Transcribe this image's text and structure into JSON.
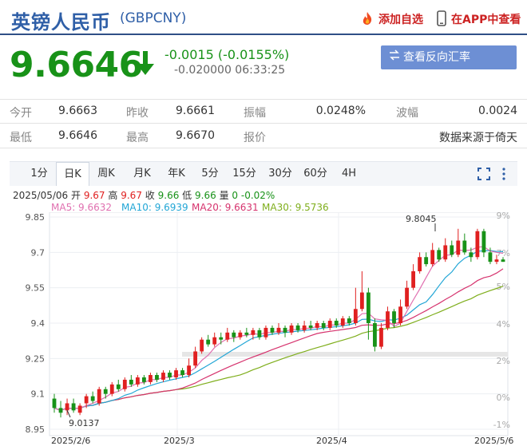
{
  "header": {
    "title": "英镑人民币",
    "code": "(GBPCNY)",
    "add_watch": "添加自选",
    "view_app": "在APP中查看"
  },
  "quote": {
    "price": "9.6646",
    "change": "-0.0015 (-0.0155%)",
    "sub": "-0.020000 06:33:25",
    "reverse_button": "查看反向汇率 CNYGBP"
  },
  "stats": {
    "row1": [
      {
        "label": "今开",
        "value": "9.6663"
      },
      {
        "label": "昨收",
        "value": "9.6661"
      },
      {
        "label": "振幅",
        "value": "0.0248%"
      },
      {
        "label": "波幅",
        "value": "0.0024"
      }
    ],
    "row2": [
      {
        "label": "最低",
        "value": "9.6646"
      },
      {
        "label": "最高",
        "value": "9.6670"
      },
      {
        "label": "报价",
        "value": ""
      },
      {
        "label": "",
        "value": "数据来源于倚天"
      }
    ]
  },
  "toolbar": {
    "tabs": [
      "1分",
      "日K",
      "周K",
      "月K",
      "年K",
      "5分",
      "15分",
      "30分",
      "60分",
      "4H"
    ],
    "active_tab": "日K"
  },
  "ohlc": {
    "date": "2025/05/06",
    "open_label": "开",
    "open": "9.67",
    "high_label": "高",
    "high": "9.67",
    "close_label": "收",
    "close": "9.66",
    "low_label": "低",
    "low": "9.66",
    "vol_label": "量",
    "vol": "0",
    "change": "-0.02%"
  },
  "ma_legend": [
    {
      "text": "MA5: 9.6632",
      "color": "#e070b0"
    },
    {
      "text": "MA10: 9.6939",
      "color": "#22a6d6"
    },
    {
      "text": "MA20: 9.6631",
      "color": "#d6336e"
    },
    {
      "text": "MA30: 9.5736",
      "color": "#7fae1c"
    }
  ],
  "colors": {
    "up": "#e02020",
    "down": "#189218",
    "brand": "#2f5fa7"
  },
  "chart_data": {
    "type": "candlestick",
    "y_left_ticks": [
      "9.85",
      "9.7",
      "9.55",
      "9.4",
      "9.25",
      "9.1",
      "8.95"
    ],
    "y_right_ticks": [
      "9%",
      "7%",
      "5%",
      "4%",
      "2%",
      "0%",
      "-1%"
    ],
    "x_ticks": [
      "2025/2/6",
      "2025/3",
      "2025/4",
      "2025/5/6"
    ],
    "annotations": {
      "max": "9.8045",
      "min": "9.0137"
    },
    "ylim": [
      8.95,
      9.85
    ],
    "candles": [
      [
        9.08,
        9.04,
        9.1,
        9.02
      ],
      [
        9.04,
        9.02,
        9.07,
        9.0
      ],
      [
        9.03,
        9.06,
        9.08,
        9.01
      ],
      [
        9.06,
        9.03,
        9.08,
        9.02
      ],
      [
        9.02,
        9.05,
        9.06,
        9.01
      ],
      [
        9.06,
        9.09,
        9.1,
        9.04
      ],
      [
        9.09,
        9.07,
        9.11,
        9.06
      ],
      [
        9.06,
        9.12,
        9.13,
        9.05
      ],
      [
        9.12,
        9.1,
        9.13,
        9.08
      ],
      [
        9.1,
        9.14,
        9.15,
        9.09
      ],
      [
        9.14,
        9.12,
        9.16,
        9.11
      ],
      [
        9.12,
        9.16,
        9.17,
        9.11
      ],
      [
        9.16,
        9.14,
        9.18,
        9.13
      ],
      [
        9.14,
        9.17,
        9.18,
        9.13
      ],
      [
        9.17,
        9.15,
        9.18,
        9.14
      ],
      [
        9.15,
        9.18,
        9.19,
        9.14
      ],
      [
        9.18,
        9.16,
        9.19,
        9.15
      ],
      [
        9.16,
        9.19,
        9.2,
        9.15
      ],
      [
        9.19,
        9.17,
        9.2,
        9.16
      ],
      [
        9.17,
        9.2,
        9.21,
        9.16
      ],
      [
        9.2,
        9.18,
        9.21,
        9.17
      ],
      [
        9.18,
        9.22,
        9.25,
        9.17
      ],
      [
        9.22,
        9.28,
        9.3,
        9.21
      ],
      [
        9.28,
        9.33,
        9.34,
        9.27
      ],
      [
        9.33,
        9.31,
        9.35,
        9.3
      ],
      [
        9.31,
        9.34,
        9.36,
        9.3
      ],
      [
        9.34,
        9.33,
        9.36,
        9.31
      ],
      [
        9.33,
        9.36,
        9.38,
        9.32
      ],
      [
        9.36,
        9.34,
        9.37,
        9.32
      ],
      [
        9.34,
        9.36,
        9.37,
        9.33
      ],
      [
        9.36,
        9.35,
        9.38,
        9.34
      ],
      [
        9.35,
        9.37,
        9.38,
        9.33
      ],
      [
        9.37,
        9.34,
        9.38,
        9.33
      ],
      [
        9.34,
        9.38,
        9.39,
        9.33
      ],
      [
        9.38,
        9.36,
        9.39,
        9.35
      ],
      [
        9.36,
        9.38,
        9.4,
        9.35
      ],
      [
        9.38,
        9.36,
        9.39,
        9.34
      ],
      [
        9.36,
        9.39,
        9.4,
        9.35
      ],
      [
        9.39,
        9.37,
        9.4,
        9.36
      ],
      [
        9.37,
        9.39,
        9.41,
        9.36
      ],
      [
        9.39,
        9.38,
        9.41,
        9.37
      ],
      [
        9.38,
        9.4,
        9.41,
        9.37
      ],
      [
        9.4,
        9.38,
        9.41,
        9.37
      ],
      [
        9.38,
        9.41,
        9.42,
        9.37
      ],
      [
        9.41,
        9.39,
        9.42,
        9.38
      ],
      [
        9.39,
        9.42,
        9.43,
        9.38
      ],
      [
        9.42,
        9.4,
        9.43,
        9.39
      ],
      [
        9.4,
        9.46,
        9.55,
        9.39
      ],
      [
        9.46,
        9.53,
        9.62,
        9.45
      ],
      [
        9.53,
        9.4,
        9.55,
        9.33
      ],
      [
        9.4,
        9.3,
        9.42,
        9.28
      ],
      [
        9.3,
        9.38,
        9.4,
        9.29
      ],
      [
        9.38,
        9.45,
        9.47,
        9.37
      ],
      [
        9.45,
        9.4,
        9.46,
        9.38
      ],
      [
        9.4,
        9.47,
        9.5,
        9.39
      ],
      [
        9.47,
        9.55,
        9.58,
        9.46
      ],
      [
        9.55,
        9.62,
        9.65,
        9.54
      ],
      [
        9.62,
        9.68,
        9.7,
        9.61
      ],
      [
        9.68,
        9.65,
        9.7,
        9.64
      ],
      [
        9.65,
        9.71,
        9.74,
        9.64
      ],
      [
        9.71,
        9.67,
        9.72,
        9.66
      ],
      [
        9.67,
        9.73,
        9.76,
        9.66
      ],
      [
        9.73,
        9.69,
        9.75,
        9.68
      ],
      [
        9.69,
        9.75,
        9.8,
        9.68
      ],
      [
        9.75,
        9.7,
        9.78,
        9.69
      ],
      [
        9.7,
        9.68,
        9.72,
        9.66
      ],
      [
        9.68,
        9.79,
        9.8,
        9.67
      ],
      [
        9.79,
        9.7,
        9.8,
        9.68
      ],
      [
        9.7,
        9.66,
        9.72,
        9.65
      ],
      [
        9.66,
        9.67,
        9.69,
        9.65
      ],
      [
        9.67,
        9.66,
        9.68,
        9.66
      ]
    ]
  }
}
